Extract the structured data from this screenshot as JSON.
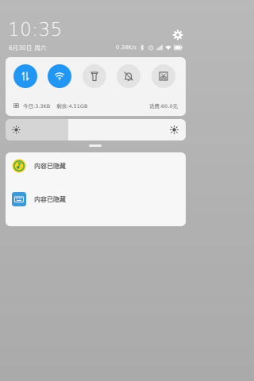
{
  "status": {
    "time": "10:35",
    "date": "6月30日",
    "weekday": "周六",
    "net_speed": "0.38K/s"
  },
  "quick_settings": {
    "tiles": [
      {
        "name": "mobile-data",
        "state": "on"
      },
      {
        "name": "wifi",
        "state": "on"
      },
      {
        "name": "flashlight",
        "state": "off"
      },
      {
        "name": "silent",
        "state": "off"
      },
      {
        "name": "screenshot",
        "state": "off"
      }
    ],
    "usage": {
      "today": "今日:3.3KB",
      "remaining": "剩余:4.51GB",
      "balance": "话费:60.0元"
    }
  },
  "brightness": {
    "level": 0.35
  },
  "notifications": [
    {
      "icon": "qq-music-icon",
      "text": "内容已隐藏"
    },
    {
      "icon": "keyboard-icon",
      "text": "内容已隐藏"
    }
  ],
  "colors": {
    "accent": "#2196f3"
  }
}
